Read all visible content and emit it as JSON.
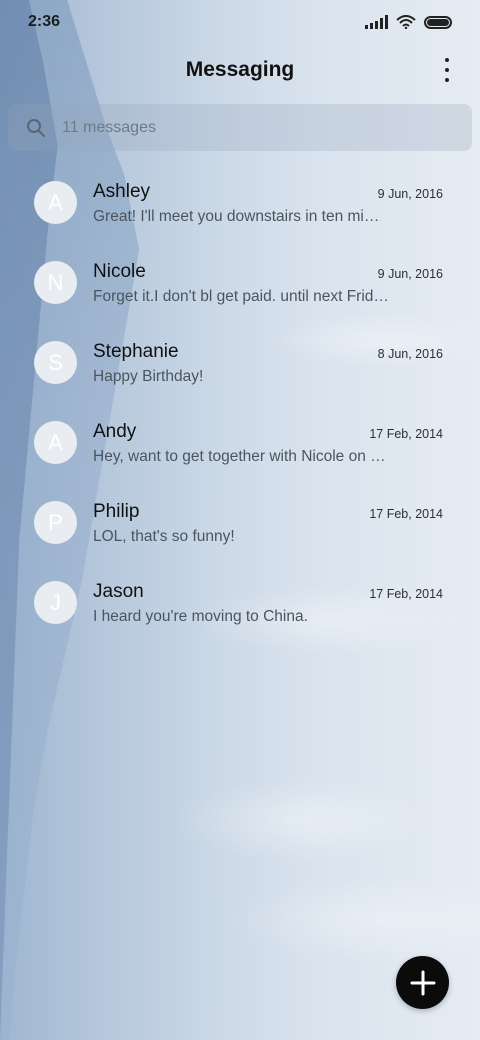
{
  "status_bar": {
    "time": "2:36"
  },
  "app_bar": {
    "title": "Messaging",
    "menu_icon": "more-vertical-icon"
  },
  "search": {
    "placeholder": "11 messages",
    "icon": "search-icon"
  },
  "conversations": [
    {
      "initial": "A",
      "name": "Ashley",
      "date": "9 Jun, 2016",
      "snippet": "Great! I'll meet you downstairs in ten mi…"
    },
    {
      "initial": "N",
      "name": "Nicole",
      "date": "9 Jun, 2016",
      "snippet": "Forget it.I don't bl get paid. until next Frid…"
    },
    {
      "initial": "S",
      "name": "Stephanie",
      "date": "8 Jun, 2016",
      "snippet": "Happy Birthday!"
    },
    {
      "initial": "A",
      "name": "Andy",
      "date": "17 Feb, 2014",
      "snippet": "Hey, want to get together with Nicole on …"
    },
    {
      "initial": "P",
      "name": "Philip",
      "date": "17 Feb, 2014",
      "snippet": "LOL, that's so funny!"
    },
    {
      "initial": "J",
      "name": "Jason",
      "date": "17 Feb, 2014",
      "snippet": "I heard you're moving to China."
    }
  ],
  "fab": {
    "icon": "plus-icon"
  },
  "colors": {
    "fab_background": "#0b0b0b",
    "title_text": "#111111",
    "snippet_text": "#4b5560"
  }
}
